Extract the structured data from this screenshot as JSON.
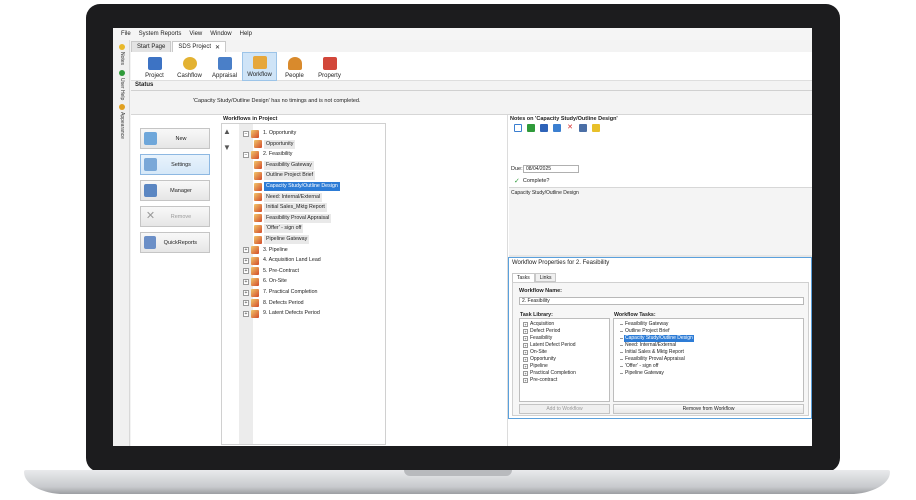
{
  "menu": {
    "items": [
      "File",
      "System Reports",
      "View",
      "Window",
      "Help"
    ]
  },
  "sidebar": {
    "items": [
      {
        "label": "Notes",
        "icon": "notes-icon",
        "color": "#e8b82a"
      },
      {
        "label": "User Help",
        "icon": "help-icon",
        "color": "#2f9a3a"
      },
      {
        "label": "Appearance",
        "icon": "appearance-icon",
        "color": "#e0a020"
      }
    ]
  },
  "doc_tabs": [
    {
      "label": "Start Page",
      "active": false
    },
    {
      "label": "SDS Project",
      "active": true,
      "close": "✕"
    }
  ],
  "ribbon": {
    "items": [
      {
        "label": "Project",
        "icon": "project-icon",
        "color": "#3d73c4"
      },
      {
        "label": "Cashflow",
        "icon": "cashflow-icon",
        "color": "#e3b232"
      },
      {
        "label": "Appraisal",
        "icon": "appraisal-icon",
        "color": "#4a7fc8"
      },
      {
        "label": "Workflow",
        "icon": "workflow-icon",
        "color": "#e6a73b",
        "active": true
      },
      {
        "label": "People",
        "icon": "people-icon",
        "color": "#d98a2c"
      },
      {
        "label": "Property",
        "icon": "property-icon",
        "color": "#d2473a"
      }
    ]
  },
  "status": {
    "heading": "Status",
    "message": "'Capacity Study/Outline Design' has no timings and is not completed."
  },
  "left_buttons": [
    {
      "label": "New",
      "icon": "new-icon",
      "color": "#6fa7da"
    },
    {
      "label": "Settings",
      "icon": "settings-icon",
      "color": "#7aa8d8",
      "highlighted": true
    },
    {
      "label": "Manager",
      "icon": "manager-icon",
      "color": "#5a86c2"
    },
    {
      "label": "Remove",
      "icon": "remove-icon",
      "color": "#9a9a9a",
      "disabled": true
    },
    {
      "label": "QuickReports",
      "icon": "quickreports-icon",
      "color": "#6b8fc7"
    }
  ],
  "workflows": {
    "title": "Workflows in Project",
    "up_arrow": "▲",
    "down_arrow": "▼",
    "nodes": [
      {
        "label": "1. Opportunity",
        "level": 0,
        "exp": "−"
      },
      {
        "label": "Opportunity",
        "level": 1
      },
      {
        "label": "2. Feasibility",
        "level": 0,
        "exp": "−"
      },
      {
        "label": "Feasibility Gateway",
        "level": 1
      },
      {
        "label": "Outline Project Brief",
        "level": 1
      },
      {
        "label": "Capacity Study/Outline Design",
        "level": 1,
        "selected": true
      },
      {
        "label": "Need: Internal/External",
        "level": 1
      },
      {
        "label": "Initial Sales_Mktg Report",
        "level": 1
      },
      {
        "label": "Feasibility Proval Appraisal",
        "level": 1
      },
      {
        "label": "'Offer' - sign off",
        "level": 1
      },
      {
        "label": "Pipeline Gateway",
        "level": 1
      },
      {
        "label": "3. Pipeline",
        "level": 0,
        "exp": "+"
      },
      {
        "label": "4. Acquisition Land Lead",
        "level": 0,
        "exp": "+"
      },
      {
        "label": "5. Pre-Contract",
        "level": 0,
        "exp": "+"
      },
      {
        "label": "6. On-Site",
        "level": 0,
        "exp": "+"
      },
      {
        "label": "7. Practical Completion",
        "level": 0,
        "exp": "+"
      },
      {
        "label": "8. Defects Period",
        "level": 0,
        "exp": "+"
      },
      {
        "label": "9. Latent Defects Period",
        "level": 0,
        "exp": "+"
      }
    ]
  },
  "notes": {
    "title": "Notes on 'Capacity Study/Outline Design'",
    "toolbar": [
      {
        "icon": "new-note-icon",
        "glyph": "▫",
        "color": "#3b7fd0"
      },
      {
        "icon": "open-note-icon",
        "glyph": "▪",
        "color": "#2f9a3a"
      },
      {
        "icon": "save-note-icon",
        "glyph": "▪",
        "color": "#2e63b8"
      },
      {
        "icon": "copy-note-icon",
        "glyph": "▪",
        "color": "#3b7fd0"
      },
      {
        "icon": "delete-note-icon",
        "glyph": "✕",
        "color": "#d12a2a"
      },
      {
        "icon": "print-note-icon",
        "glyph": "▪",
        "color": "#4b6fa6"
      },
      {
        "icon": "sticky-note-icon",
        "glyph": "▪",
        "color": "#e8c02a"
      }
    ],
    "due_label": "Due:",
    "due_value": "08/04/2025",
    "complete_check": "✓",
    "complete_label": "Complete?",
    "body_text": "Capacity Study/Outline Design"
  },
  "workflow_properties": {
    "title": "Workflow Properties for 2. Feasibility",
    "tabs": [
      {
        "label": "Tasks",
        "active": true
      },
      {
        "label": "Links",
        "active": false
      }
    ],
    "name_label": "Workflow Name:",
    "name_value": "2. Feasibility",
    "task_library_label": "Task Library:",
    "task_library": [
      "Acquisition",
      "Defect Period",
      "Feasibility",
      "Latent Defect Period",
      "On-Site",
      "Opportunity",
      "Pipeline",
      "Practical Completion",
      "Pre-contract"
    ],
    "workflow_tasks_label": "Workflow Tasks:",
    "workflow_tasks": [
      "Feasibility Gateway",
      "Outline Project Brief",
      "Capacity Study/Outline Design",
      "Need: Internal/External",
      "Initial Sales & Mktg Report",
      "Feasibility Proval Appraisal",
      "'Offer' - sign off",
      "Pipeline Gateway"
    ],
    "selected_task": "Capacity Study/Outline Design",
    "add_label": "Add to Workflow",
    "remove_label": "Remove from Workflow"
  }
}
